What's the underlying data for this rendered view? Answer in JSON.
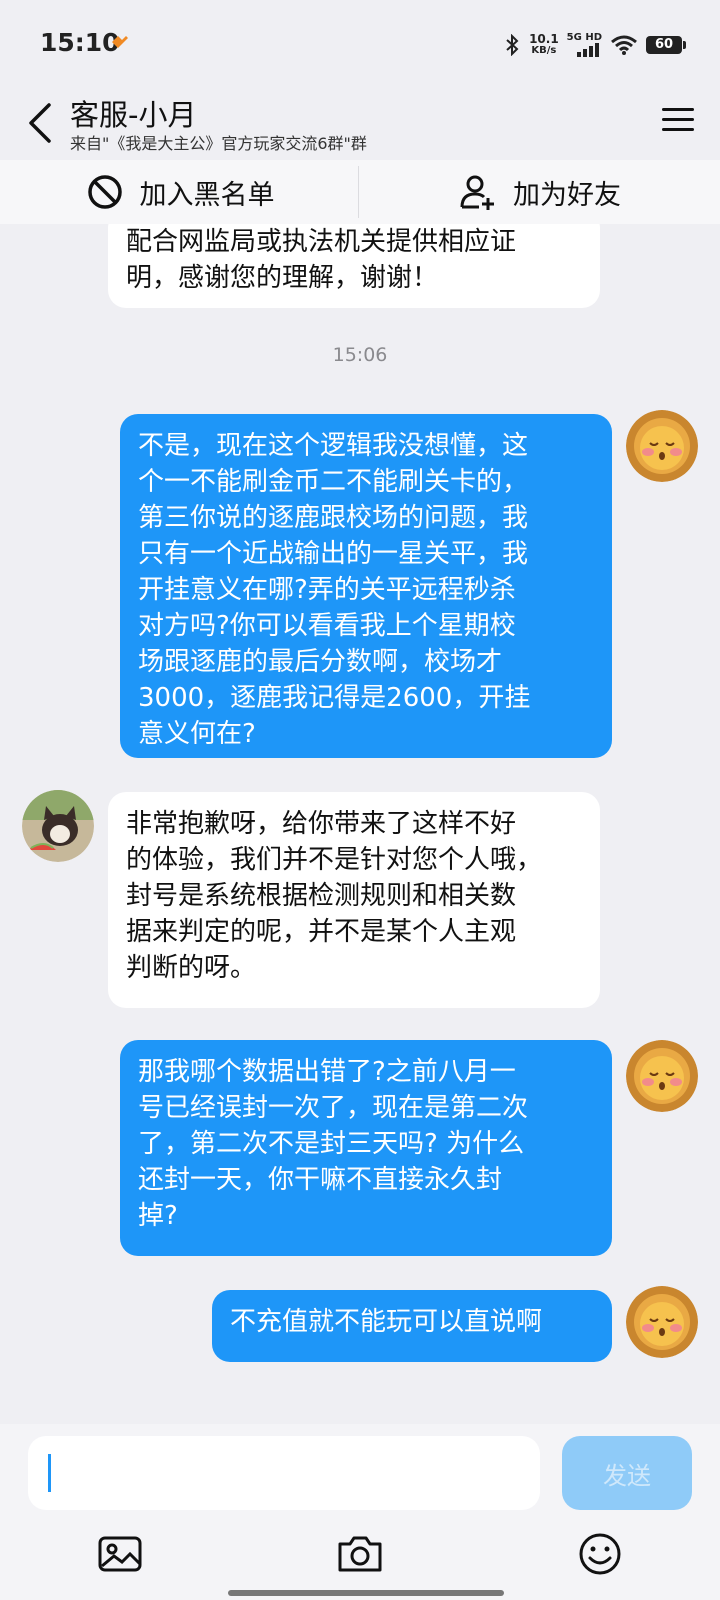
{
  "status": {
    "time": "15:10",
    "speed_value": "10.1",
    "speed_unit": "KB/s",
    "network": "5G HD",
    "battery": "60"
  },
  "header": {
    "title": "客服-小月",
    "subtitle": "来自\"《我是大主公》官方玩家交流6群\"群"
  },
  "actions": {
    "blacklist_label": "加入黑名单",
    "add_friend_label": "加为好友"
  },
  "messages": [
    {
      "side": "in",
      "lines": [
        "配合网监局或执法机关提供相应证",
        "明，感谢您的理解，谢谢！"
      ]
    },
    {
      "side": "time",
      "text": "15:06"
    },
    {
      "side": "out",
      "lines": [
        "不是，现在这个逻辑我没想懂，这",
        "个一不能刷金币二不能刷关卡的，",
        "第三你说的逐鹿跟校场的问题，我",
        "只有一个近战输出的一星关平，我",
        "开挂意义在哪?弄的关平远程秒杀",
        "对方吗?你可以看看我上个星期校",
        "场跟逐鹿的最后分数啊，校场才",
        "3000，逐鹿我记得是2600，开挂",
        "意义何在?"
      ]
    },
    {
      "side": "in",
      "lines": [
        "非常抱歉呀，给你带来了这样不好",
        "的体验，我们并不是针对您个人哦，",
        "封号是系统根据检测规则和相关数",
        "据来判定的呢，并不是某个人主观",
        "判断的呀。"
      ]
    },
    {
      "side": "out",
      "lines": [
        "那我哪个数据出错了?之前八月一",
        "号已经误封一次了，现在是第二次",
        "了，第二次不是封三天吗? 为什么",
        "还封一天，你干嘛不直接永久封",
        "掉?"
      ]
    },
    {
      "side": "out",
      "lines": [
        "不充值就不能玩可以直说啊"
      ]
    }
  ],
  "input": {
    "value": "",
    "send_label": "发送"
  },
  "colors": {
    "accent": "#1e96f8",
    "background": "#efeff3"
  }
}
